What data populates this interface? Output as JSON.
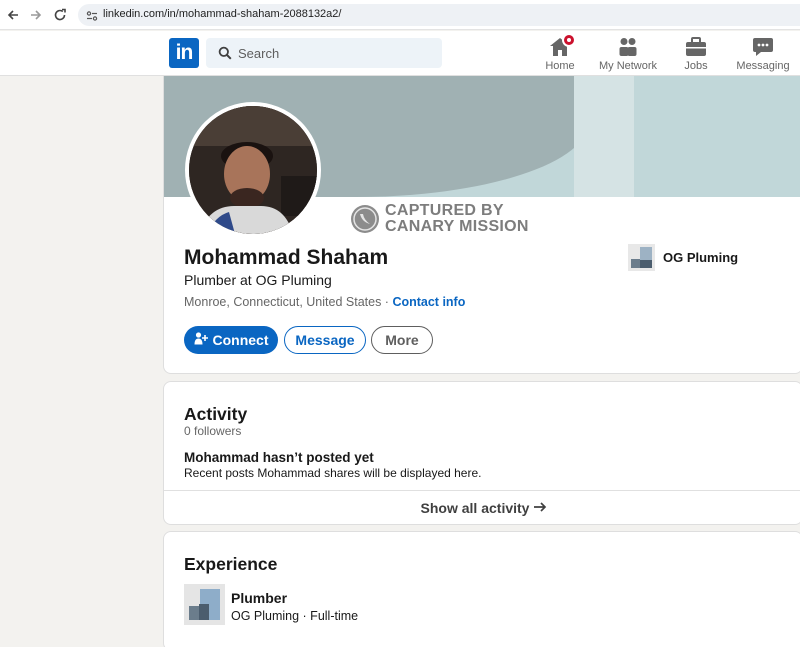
{
  "browser": {
    "url": "linkedin.com/in/mohammad-shaham-2088132a2/"
  },
  "header": {
    "logo_text": "in",
    "search_placeholder": "Search",
    "nav": [
      {
        "label": "Home",
        "icon": "home-icon"
      },
      {
        "label": "My Network",
        "icon": "network-icon"
      },
      {
        "label": "Jobs",
        "icon": "briefcase-icon"
      },
      {
        "label": "Messaging",
        "icon": "chat-icon"
      }
    ]
  },
  "profile": {
    "name": "Mohammad Shaham",
    "headline": "Plumber at OG Pluming",
    "location": "Monroe, Connecticut, United States",
    "location_separator": " · ",
    "contact_info": "Contact info",
    "company": "OG Pluming",
    "watermark_line1": "CAPTURED BY",
    "watermark_line2": "CANARY MISSION",
    "buttons": {
      "connect": "Connect",
      "message": "Message",
      "more": "More"
    }
  },
  "activity": {
    "title": "Activity",
    "followers": "0 followers",
    "empty_title": "Mohammad hasn’t posted yet",
    "empty_sub": "Recent posts Mohammad shares will be displayed here.",
    "show_all": "Show all activity"
  },
  "experience": {
    "title": "Experience",
    "role": "Plumber",
    "company_line": "OG Pluming · Full-time"
  },
  "colors": {
    "brand": "#0a66c2",
    "page_bg": "#f3f2ef",
    "badge": "#cb112d"
  }
}
